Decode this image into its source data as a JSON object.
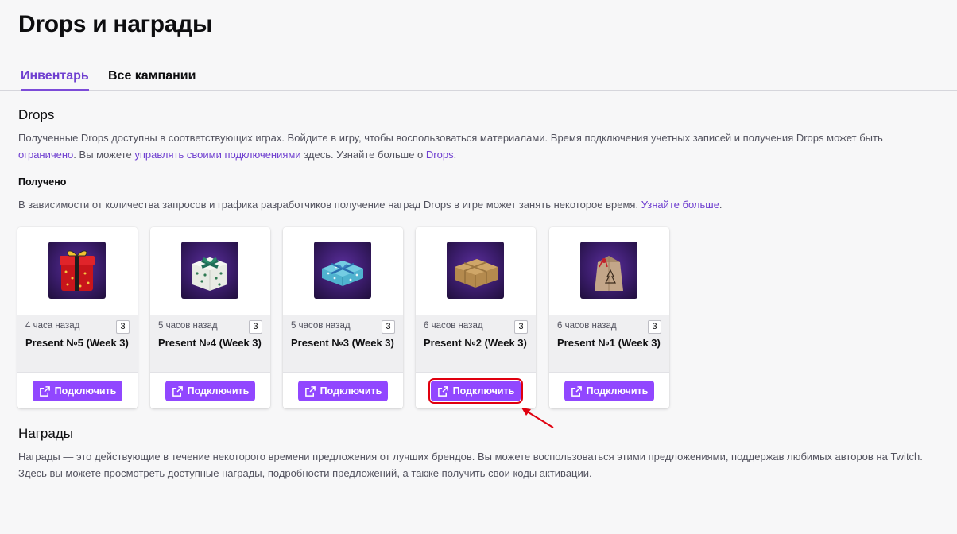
{
  "page": {
    "title": "Drops и награды"
  },
  "tabs": [
    {
      "label": "Инвентарь",
      "active": true
    },
    {
      "label": "Все кампании",
      "active": false
    }
  ],
  "drops": {
    "title": "Drops",
    "desc_part1": "Полученные Drops доступны в соответствующих играх. Войдите в игру, чтобы воспользоваться материалами. Время подключения учетных записей и получения Drops может быть ",
    "link_limited": "ограничено",
    "desc_part2": ". Вы можете ",
    "link_manage": "управлять своими подключениями",
    "desc_part3": " здесь. Узнайте больше о ",
    "link_drops": "Drops",
    "desc_part4": "."
  },
  "received": {
    "title": "Получено",
    "desc": "В зависимости от количества запросов и графика разработчиков получение наград Drops в игре может занять некоторое время. ",
    "link_more": "Узнайте больше",
    "desc_end": "."
  },
  "cards": [
    {
      "time": "4 часа назад",
      "count": "3",
      "name": "Present №5 (Week 3)",
      "button": "Подключить",
      "image": "red-gift-box"
    },
    {
      "time": "5 часов назад",
      "count": "3",
      "name": "Present №4 (Week 3)",
      "button": "Подключить",
      "image": "white-green-gift-box"
    },
    {
      "time": "5 часов назад",
      "count": "3",
      "name": "Present №3 (Week 3)",
      "button": "Подключить",
      "image": "blue-gift-box"
    },
    {
      "time": "6 часов назад",
      "count": "3",
      "name": "Present №2 (Week 3)",
      "button": "Подключить",
      "image": "brown-parcel"
    },
    {
      "time": "6 часов назад",
      "count": "3",
      "name": "Present №1 (Week 3)",
      "button": "Подключить",
      "image": "paper-bag"
    }
  ],
  "rewards": {
    "title": "Награды",
    "desc": "Награды — это действующие в течение некоторого времени предложения от лучших брендов. Вы можете воспользоваться этими предложениями, поддержав любимых авторов на Twitch. Здесь вы можете просмотреть доступные награды, подробности предложений, а также получить свои коды активации."
  },
  "colors": {
    "accent": "#9147ff",
    "link": "#6f3fd0",
    "highlight": "#e0000f"
  }
}
